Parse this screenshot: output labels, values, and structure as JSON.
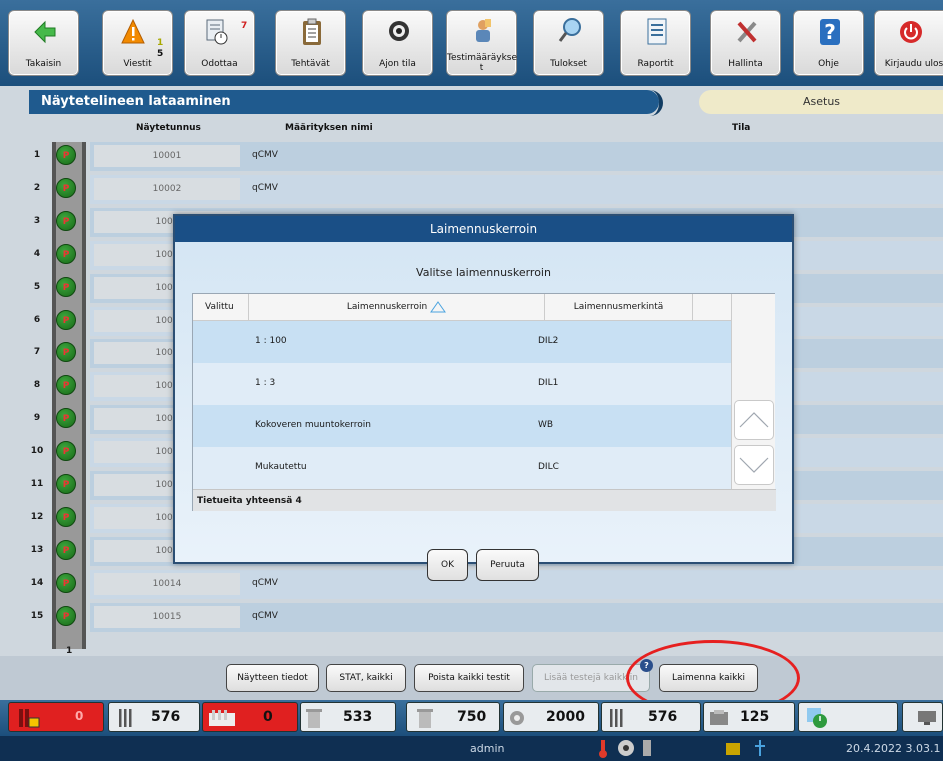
{
  "toolbar": {
    "buttons": [
      {
        "label": "Takaisin",
        "icon": "back-arrow-icon"
      },
      {
        "label": "Viestit",
        "icon": "warning-icon",
        "count_top": "1",
        "count_bottom": "5"
      },
      {
        "label": "Odottaa",
        "icon": "pending-icon",
        "count": "7"
      },
      {
        "label": "Tehtävät",
        "icon": "clipboard-icon"
      },
      {
        "label": "Ajon tila",
        "icon": "run-status-icon"
      },
      {
        "label": "Testimääräykse\nt",
        "icon": "test-order-icon"
      },
      {
        "label": "Tulokset",
        "icon": "results-icon"
      },
      {
        "label": "Raportit",
        "icon": "reports-icon"
      },
      {
        "label": "Hallinta",
        "icon": "tools-icon"
      },
      {
        "label": "Ohje",
        "icon": "help-icon"
      },
      {
        "label": "Kirjaudu ulos",
        "icon": "power-icon"
      }
    ]
  },
  "page": {
    "title": "Näytetelineen lataaminen",
    "asetus": "Asetus",
    "col_sample_id": "Näytetunnus",
    "col_assay": "Määrityksen nimi",
    "col_status": "Tila",
    "rack_number": "1"
  },
  "rows": [
    {
      "num": "1",
      "pos": "P",
      "sample": "10001",
      "assay": "qCMV"
    },
    {
      "num": "2",
      "pos": "P",
      "sample": "10002",
      "assay": "qCMV"
    },
    {
      "num": "3",
      "pos": "P",
      "sample": "1000",
      "assay": ""
    },
    {
      "num": "4",
      "pos": "P",
      "sample": "1000",
      "assay": ""
    },
    {
      "num": "5",
      "pos": "P",
      "sample": "1000",
      "assay": ""
    },
    {
      "num": "6",
      "pos": "P",
      "sample": "1000",
      "assay": ""
    },
    {
      "num": "7",
      "pos": "P",
      "sample": "1000",
      "assay": ""
    },
    {
      "num": "8",
      "pos": "P",
      "sample": "1000",
      "assay": ""
    },
    {
      "num": "9",
      "pos": "P",
      "sample": "1000",
      "assay": ""
    },
    {
      "num": "10",
      "pos": "P",
      "sample": "1001",
      "assay": ""
    },
    {
      "num": "11",
      "pos": "P",
      "sample": "1001",
      "assay": ""
    },
    {
      "num": "12",
      "pos": "P",
      "sample": "1001",
      "assay": ""
    },
    {
      "num": "13",
      "pos": "P",
      "sample": "1001",
      "assay": "qCMV"
    },
    {
      "num": "14",
      "pos": "P",
      "sample": "10014",
      "assay": "qCMV"
    },
    {
      "num": "15",
      "pos": "P",
      "sample": "10015",
      "assay": "qCMV"
    }
  ],
  "bottom_buttons": {
    "details": "Näytteen tiedot",
    "stat_all": "STAT, kaikki",
    "remove_all": "Poista kaikki testit",
    "add_all": "Lisää testejä kaikkiin",
    "dilute_all": "Laimenna kaikki",
    "help_mark": "?"
  },
  "status": {
    "v0": "0",
    "v576": "576",
    "v0b": "0",
    "v533": "533",
    "v750": "750",
    "v2000": "2000",
    "v576b": "576",
    "v125": "125",
    "user": "admin",
    "datetime": "20.4.2022 3.03.1"
  },
  "dialog": {
    "title": "Laimennuskerroin",
    "subtitle": "Valitse laimennuskerroin",
    "col_selected": "Valittu",
    "col_factor": "Laimennuskerroin",
    "col_mark": "Laimennusmerkintä",
    "items": [
      {
        "factor": "1 : 100",
        "mark": "DIL2"
      },
      {
        "factor": "1 : 3",
        "mark": "DIL1"
      },
      {
        "factor": "Kokoveren muuntokerroin",
        "mark": "WB"
      },
      {
        "factor": "Mukautettu",
        "mark": "DILC"
      }
    ],
    "footer": "Tietueita yhteensä 4",
    "ok": "OK",
    "cancel": "Peruuta"
  },
  "colors": {
    "header_blue": "#1f5a8e",
    "dialog_title": "#1a4f86",
    "highlight_red": "#e62020",
    "pos_green": "#2a8a2a"
  }
}
